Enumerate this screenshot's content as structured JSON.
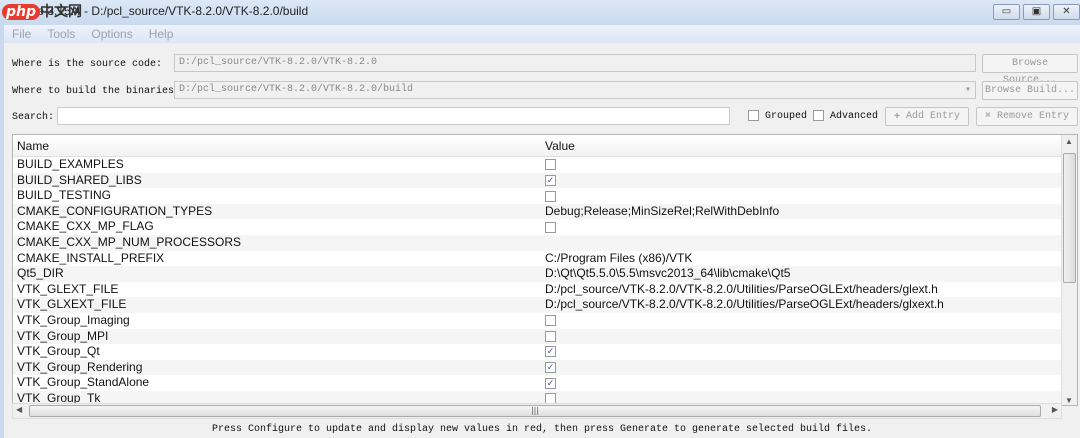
{
  "window": {
    "title": "CMake 3.15.4 - D:/pcl_source/VTK-8.2.0/VTK-8.2.0/build",
    "watermark": "php中文网",
    "minimize": "▭",
    "maximize": "▣",
    "close": "✕"
  },
  "menu": [
    "File",
    "Tools",
    "Options",
    "Help"
  ],
  "source": {
    "label": "Where is the source code:",
    "value": "D:/pcl_source/VTK-8.2.0/VTK-8.2.0",
    "button": "Browse Source..."
  },
  "build": {
    "label": "Where to build the binaries:",
    "value": "D:/pcl_source/VTK-8.2.0/VTK-8.2.0/build",
    "button": "Browse Build..."
  },
  "search": {
    "label": "Search:",
    "value": "",
    "grouped": "Grouped",
    "grouped_checked": false,
    "advanced": "Advanced",
    "advanced_checked": false,
    "add_entry": "Add Entry",
    "remove_entry": "Remove Entry"
  },
  "table": {
    "columns": [
      "Name",
      "Value"
    ],
    "rows": [
      {
        "name": "BUILD_EXAMPLES",
        "type": "bool",
        "value": false
      },
      {
        "name": "BUILD_SHARED_LIBS",
        "type": "bool",
        "value": true
      },
      {
        "name": "BUILD_TESTING",
        "type": "bool",
        "value": false
      },
      {
        "name": "CMAKE_CONFIGURATION_TYPES",
        "type": "text",
        "value": "Debug;Release;MinSizeRel;RelWithDebInfo"
      },
      {
        "name": "CMAKE_CXX_MP_FLAG",
        "type": "bool",
        "value": false
      },
      {
        "name": "CMAKE_CXX_MP_NUM_PROCESSORS",
        "type": "text",
        "value": ""
      },
      {
        "name": "CMAKE_INSTALL_PREFIX",
        "type": "text",
        "value": "C:/Program Files (x86)/VTK"
      },
      {
        "name": "Qt5_DIR",
        "type": "text",
        "value": "D:\\Qt\\Qt5.5.0\\5.5\\msvc2013_64\\lib\\cmake\\Qt5"
      },
      {
        "name": "VTK_GLEXT_FILE",
        "type": "text",
        "value": "D:/pcl_source/VTK-8.2.0/VTK-8.2.0/Utilities/ParseOGLExt/headers/glext.h"
      },
      {
        "name": "VTK_GLXEXT_FILE",
        "type": "text",
        "value": "D:/pcl_source/VTK-8.2.0/VTK-8.2.0/Utilities/ParseOGLExt/headers/glxext.h"
      },
      {
        "name": "VTK_Group_Imaging",
        "type": "bool",
        "value": false
      },
      {
        "name": "VTK_Group_MPI",
        "type": "bool",
        "value": false
      },
      {
        "name": "VTK_Group_Qt",
        "type": "bool",
        "value": true
      },
      {
        "name": "VTK_Group_Rendering",
        "type": "bool",
        "value": true
      },
      {
        "name": "VTK_Group_StandAlone",
        "type": "bool",
        "value": true
      },
      {
        "name": "VTK_Group_Tk",
        "type": "bool",
        "value": false
      }
    ]
  },
  "status": "Press Configure to update and display new values in red, then press Generate to generate selected build files."
}
